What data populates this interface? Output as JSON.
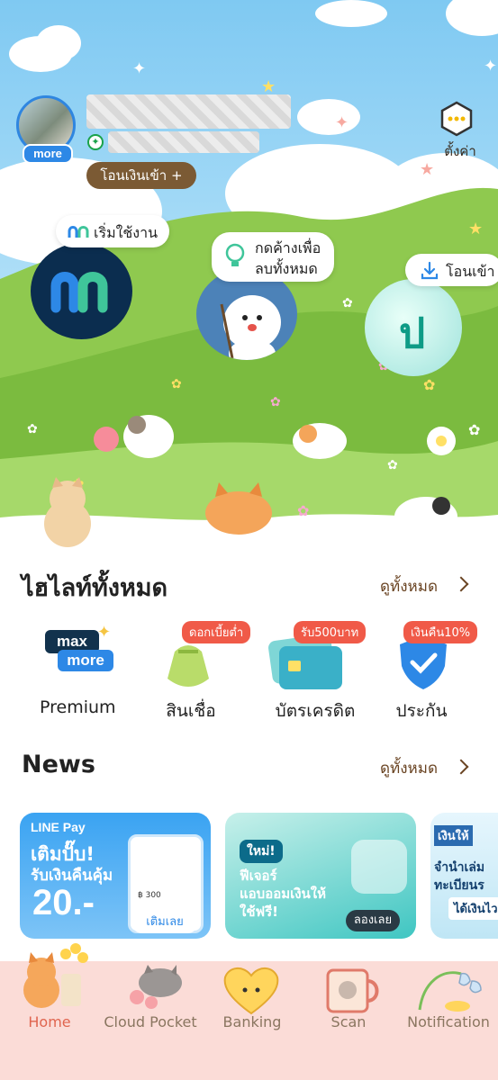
{
  "header": {
    "avatar_badge": "more",
    "transfer_in_button": "โอนเงินเข้า +",
    "settings_label": "ตั้งค่า"
  },
  "shortcuts": [
    {
      "label": "เริ่มใช้งาน",
      "icon": "m-logo-icon"
    },
    {
      "label_line1": "กดค้างเพื่อ",
      "label_line2": "ลบทั้งหมด",
      "icon": "lightbulb-icon"
    },
    {
      "label": "โอนเข้า",
      "icon": "download-icon",
      "circle_text": "ป"
    }
  ],
  "highlights": {
    "title": "ไฮไลท์ทั้งหมด",
    "see_all": "ดูทั้งหมด",
    "items": [
      {
        "label": "Premium",
        "logo_top": "max",
        "logo_bottom": "more",
        "badge": ""
      },
      {
        "label": "สินเชื่อ",
        "badge": "ดอกเบี้ยต่ำ"
      },
      {
        "label": "บัตรเครดิต",
        "badge": "รับ500บาท"
      },
      {
        "label": "ประกัน",
        "badge": "เงินคืน10%"
      }
    ]
  },
  "news": {
    "title": "News",
    "see_all": "ดูทั้งหมด",
    "cards": [
      {
        "brand": "LINE Pay",
        "headline_1": "เติมปั๊บ!",
        "headline_2": "รับเงินคืนคุ้ม",
        "amount": "20.-",
        "cta": "เติมเลย",
        "phone_amount": "฿ 300"
      },
      {
        "tag": "ใหม่!",
        "headline_1": "ฟีเจอร์",
        "headline_2": "แอบออมเงินให้",
        "headline_3": "ใช้ฟรี!",
        "cta": "ลองเลย"
      },
      {
        "brand": "เงินให้",
        "line_1": "จำนำเล่ม",
        "line_2": "ทะเบียนร",
        "line_3": "ได้เงินไว"
      }
    ]
  },
  "tabbar": {
    "items": [
      {
        "label": "Home",
        "active": true,
        "icon": "cat-flowers-icon"
      },
      {
        "label": "Cloud Pocket",
        "active": false,
        "icon": "cat-cloud-icon"
      },
      {
        "label": "Banking",
        "active": false,
        "icon": "heart-cat-icon"
      },
      {
        "label": "Scan",
        "active": false,
        "icon": "mug-cat-icon"
      },
      {
        "label": "Notification",
        "active": false,
        "icon": "bell-flower-icon"
      }
    ]
  },
  "colors": {
    "accent_brown": "#7b5a34",
    "see_all_brown": "#6a4423",
    "active_tab": "#e0654f",
    "inactive_tab": "#8a7660",
    "tabbar_bg": "#fbdcd7",
    "badge_red": "#f05a48",
    "brand_blue": "#2d88e6"
  }
}
